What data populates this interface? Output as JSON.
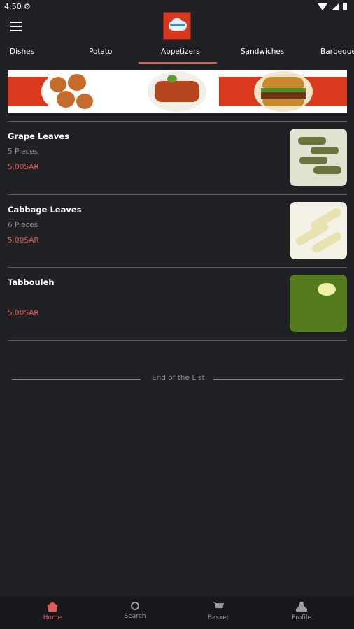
{
  "status": {
    "time": "4:50"
  },
  "tabs": [
    {
      "label": "Dishes"
    },
    {
      "label": "Potato"
    },
    {
      "label": "Appetizers"
    },
    {
      "label": "Sandwiches"
    },
    {
      "label": "Barbeque"
    }
  ],
  "selected_tab": "Appetizers",
  "items": [
    {
      "name": "Grape Leaves",
      "desc": "5 Pieces",
      "price": "5.00SAR"
    },
    {
      "name": "Cabbage Leaves",
      "desc": "6 Pieces",
      "price": "5.00SAR"
    },
    {
      "name": "Tabbouleh",
      "desc": "",
      "price": "5.00SAR"
    }
  ],
  "end_text": "End of the List",
  "nav": [
    {
      "label": "Home",
      "icon": "home-icon"
    },
    {
      "label": "Search",
      "icon": "search-icon"
    },
    {
      "label": "Basket",
      "icon": "cart-icon"
    },
    {
      "label": "Profile",
      "icon": "profile-icon"
    }
  ],
  "colors": {
    "background": "#202125",
    "accent": "#e25b57",
    "bottom_nav": "#17181b"
  }
}
